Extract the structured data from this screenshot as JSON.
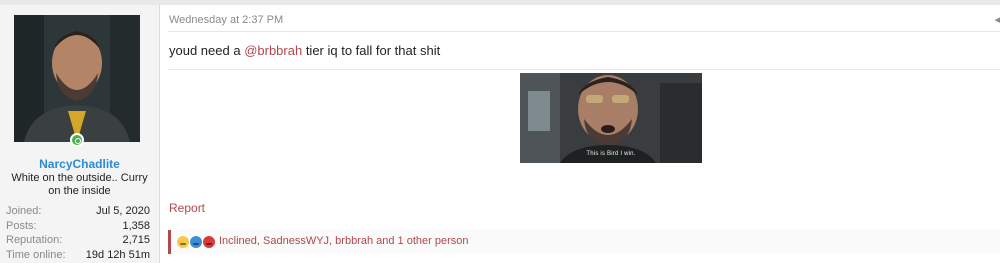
{
  "user": {
    "username": "NarcyChadlite",
    "user_title": "White on the outside.. Curry on the inside",
    "online_status": "online",
    "stats": [
      {
        "label": "Joined:",
        "value": "Jul 5, 2020"
      },
      {
        "label": "Posts:",
        "value": "1,358"
      },
      {
        "label": "Reputation:",
        "value": "2,715"
      },
      {
        "label": "Time online:",
        "value": "19d 12h 51m"
      }
    ]
  },
  "post": {
    "date": "Wednesday at 2:37 PM",
    "text_before": "youd need a ",
    "mention": "@brbbrah",
    "text_after": " tier iq to fall for that shit",
    "media_caption": "This is Bird I win.",
    "report_label": "Report",
    "menu_glyph": "◂"
  },
  "reactions": {
    "icons": [
      "laugh-reaction-icon",
      "cool-reaction-icon",
      "angry-reaction-icon"
    ],
    "summary": "Inclined, SadnessWYJ, brbbrah and 1 other person"
  },
  "colors": {
    "accent": "#b0484e",
    "username": "#2a8bd6",
    "online": "#4caf50"
  }
}
